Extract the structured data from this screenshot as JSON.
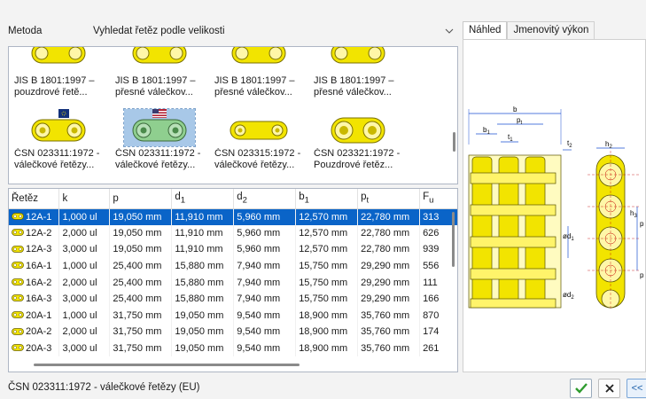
{
  "method": {
    "label": "Metoda",
    "selected": "Vyhledat řetěz podle velikosti"
  },
  "gallery": {
    "row1": [
      {
        "line1": "JIS B 1801:1997 –",
        "line2": "pouzdrové řetě..."
      },
      {
        "line1": "JIS B 1801:1997 –",
        "line2": "přesné válečkov..."
      },
      {
        "line1": "JIS B 1801:1997 –",
        "line2": "přesné válečkov..."
      },
      {
        "line1": "JIS B 1801:1997 –",
        "line2": "přesné válečkov..."
      }
    ],
    "row2": [
      {
        "line1": "ČSN 023311:1972 -",
        "line2": "válečkové řetězy..."
      },
      {
        "line1": "ČSN 023311:1972 -",
        "line2": "válečkové řetězy..."
      },
      {
        "line1": "ČSN 023315:1972 -",
        "line2": "válečkové řetězy..."
      },
      {
        "line1": "ČSN 023321:1972 -",
        "line2": "Pouzdrové řetěz..."
      }
    ]
  },
  "table": {
    "headers": {
      "chain": "Řetěz",
      "k": "k",
      "p": "p",
      "d": "d",
      "d1_sub": "1",
      "d2_sub": "2",
      "b": "b",
      "b1_sub": "1",
      "pt": "p",
      "pt_sub": "t",
      "f": "F",
      "f_sub": "u"
    },
    "rows": [
      {
        "name": "12A-1",
        "k": "1,000 ul",
        "p": "19,050 mm",
        "d1": "11,910 mm",
        "d2": "5,960 mm",
        "b1": "12,570 mm",
        "pt": "22,780 mm",
        "fu": "313",
        "selected": true
      },
      {
        "name": "12A-2",
        "k": "2,000 ul",
        "p": "19,050 mm",
        "d1": "11,910 mm",
        "d2": "5,960 mm",
        "b1": "12,570 mm",
        "pt": "22,780 mm",
        "fu": "626"
      },
      {
        "name": "12A-3",
        "k": "3,000 ul",
        "p": "19,050 mm",
        "d1": "11,910 mm",
        "d2": "5,960 mm",
        "b1": "12,570 mm",
        "pt": "22,780 mm",
        "fu": "939"
      },
      {
        "name": "16A-1",
        "k": "1,000 ul",
        "p": "25,400 mm",
        "d1": "15,880 mm",
        "d2": "7,940 mm",
        "b1": "15,750 mm",
        "pt": "29,290 mm",
        "fu": "556"
      },
      {
        "name": "16A-2",
        "k": "2,000 ul",
        "p": "25,400 mm",
        "d1": "15,880 mm",
        "d2": "7,940 mm",
        "b1": "15,750 mm",
        "pt": "29,290 mm",
        "fu": "111"
      },
      {
        "name": "16A-3",
        "k": "3,000 ul",
        "p": "25,400 mm",
        "d1": "15,880 mm",
        "d2": "7,940 mm",
        "b1": "15,750 mm",
        "pt": "29,290 mm",
        "fu": "166"
      },
      {
        "name": "20A-1",
        "k": "1,000 ul",
        "p": "31,750 mm",
        "d1": "19,050 mm",
        "d2": "9,540 mm",
        "b1": "18,900 mm",
        "pt": "35,760 mm",
        "fu": "870"
      },
      {
        "name": "20A-2",
        "k": "2,000 ul",
        "p": "31,750 mm",
        "d1": "19,050 mm",
        "d2": "9,540 mm",
        "b1": "18,900 mm",
        "pt": "35,760 mm",
        "fu": "174"
      },
      {
        "name": "20A-3",
        "k": "3,000 ul",
        "p": "31,750 mm",
        "d1": "19,050 mm",
        "d2": "9,540 mm",
        "b1": "18,900 mm",
        "pt": "35,760 mm",
        "fu": "261"
      }
    ]
  },
  "tabs": {
    "preview": "Náhled",
    "power": "Jmenovitý výkon"
  },
  "diagram": {
    "b": "b",
    "pt": "p",
    "pt_sub": "t",
    "b1": "b",
    "b1_sub": "1",
    "t1": "t",
    "t1_sub": "1",
    "t2": "t",
    "t2_sub": "2",
    "h2": "h",
    "h2_sub": "2",
    "h3": "h",
    "h3_sub": "3",
    "d1": "ød",
    "d1_sub": "1",
    "d2": "ød",
    "d2_sub": "2",
    "p1": "p",
    "p2": "p"
  },
  "status": {
    "text": "ČSN 023311:1972 - válečkové řetězy (EU)"
  },
  "buttons": {
    "back": "<<"
  },
  "colors": {
    "chain_yellow": "#f2e400",
    "selection": "#0a64c8",
    "ok_green": "#2e9b2e"
  }
}
